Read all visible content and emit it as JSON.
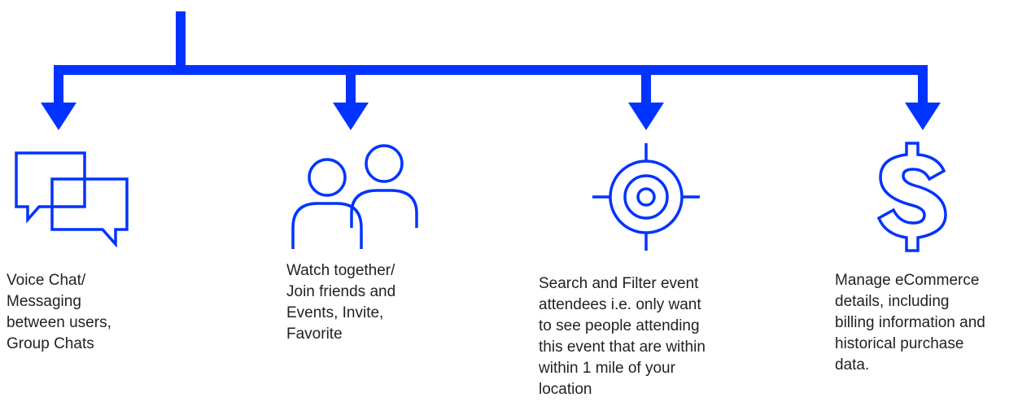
{
  "colors": {
    "accent": "#0033ff",
    "text": "#222222"
  },
  "features": [
    {
      "icon": "chat-bubbles-icon",
      "label": "Voice Chat/\nMessaging\nbetween users,\nGroup Chats"
    },
    {
      "icon": "people-icon",
      "label": "Watch together/\nJoin friends and\nEvents, Invite,\nFavorite"
    },
    {
      "icon": "target-icon",
      "label": "Search and Filter event\nattendees i.e. only want\nto see people attending\nthis event that are within\nwithin 1 mile of your\nlocation"
    },
    {
      "icon": "dollar-sign-icon",
      "label": "Manage eCommerce\ndetails, including\nbilling information and\nhistorical purchase\ndata."
    }
  ]
}
